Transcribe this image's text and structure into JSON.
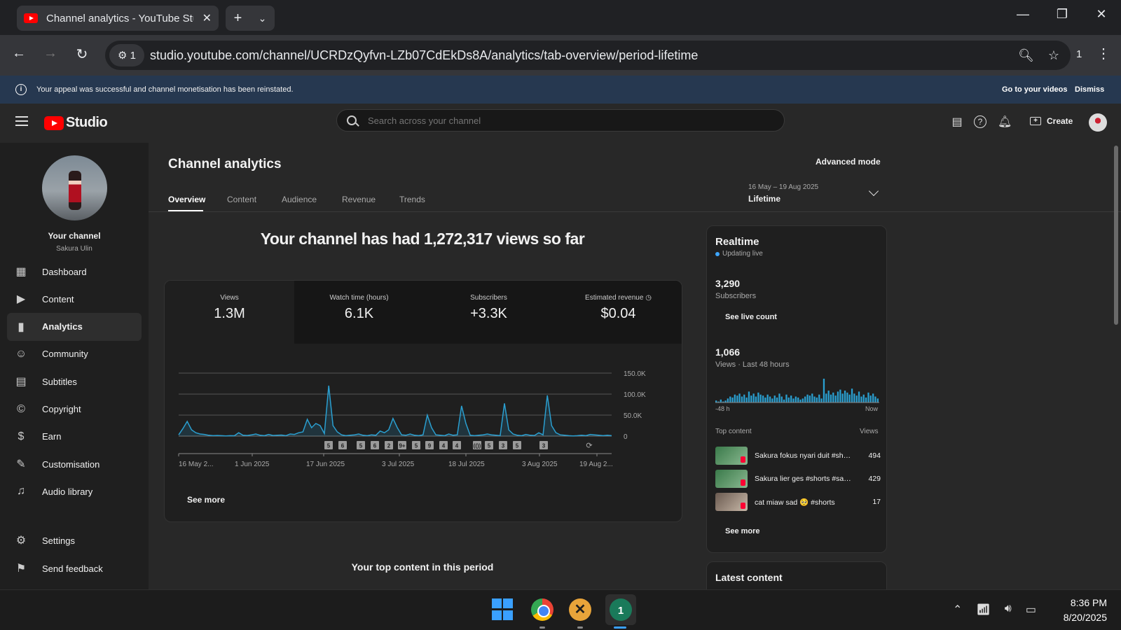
{
  "browser": {
    "tab_title": "Channel analytics - YouTube Studio",
    "url": "studio.youtube.com/channel/UCRDzQyfvn-LZb07CdEkDs8A/analytics/tab-overview/period-lifetime",
    "site_chip": "1",
    "extension_count": "1"
  },
  "banner": {
    "message": "Your appeal was successful and channel monetisation has been reinstated.",
    "go_to_videos": "Go to your videos",
    "dismiss": "Dismiss"
  },
  "studio": {
    "logo_text": "Studio",
    "search_placeholder": "Search across your channel",
    "create_label": "Create"
  },
  "channel": {
    "name": "Your channel",
    "handle": "Sakura Ulin"
  },
  "sidebar": {
    "items": [
      {
        "label": "Dashboard",
        "icon": "dashboard-icon"
      },
      {
        "label": "Content",
        "icon": "content-icon"
      },
      {
        "label": "Analytics",
        "icon": "analytics-icon",
        "active": true
      },
      {
        "label": "Community",
        "icon": "community-icon"
      },
      {
        "label": "Subtitles",
        "icon": "subtitles-icon"
      },
      {
        "label": "Copyright",
        "icon": "copyright-icon"
      },
      {
        "label": "Earn",
        "icon": "earn-icon"
      },
      {
        "label": "Customisation",
        "icon": "customisation-icon"
      },
      {
        "label": "Audio library",
        "icon": "audio-library-icon"
      }
    ],
    "settings": "Settings",
    "feedback": "Send feedback"
  },
  "page": {
    "title": "Channel analytics",
    "advanced_mode": "Advanced mode",
    "tabs": [
      "Overview",
      "Content",
      "Audience",
      "Revenue",
      "Trends"
    ],
    "date_range": "16 May – 19 Aug 2025",
    "period": "Lifetime",
    "headline": "Your channel has had 1,272,317 views so far",
    "see_more": "See more",
    "top_content_title": "Your top content in this period"
  },
  "metrics": [
    {
      "label": "Views",
      "value": "1.3M"
    },
    {
      "label": "Watch time (hours)",
      "value": "6.1K"
    },
    {
      "label": "Subscribers",
      "value": "+3.3K"
    },
    {
      "label": "Estimated revenue",
      "value": "$0.04"
    }
  ],
  "chart_data": {
    "type": "line",
    "title": "",
    "xlabel": "",
    "ylabel": "",
    "ylim": [
      0,
      150000
    ],
    "y_ticks": [
      "150.0K",
      "100.0K",
      "50.0K",
      "0"
    ],
    "x_ticks": [
      "16 May 2...",
      "1 Jun 2025",
      "17 Jun 2025",
      "3 Jul 2025",
      "18 Jul 2025",
      "3 Aug 2025",
      "19 Aug 2..."
    ],
    "series": [
      {
        "values": [
          3000,
          18000,
          35000,
          15000,
          8000,
          5000,
          4000,
          2000,
          1000,
          1500,
          1000,
          500,
          1000,
          800,
          8000,
          2000,
          1500,
          3000,
          5000,
          2000,
          1000,
          4000,
          1500,
          2000,
          2500,
          1000,
          5000,
          4000,
          8000,
          10000,
          40000,
          20000,
          30000,
          25000,
          6000,
          120000,
          25000,
          10000,
          3000,
          1000,
          2000,
          3000,
          5000,
          2000,
          1000,
          3000,
          2000,
          12000,
          8000,
          15000,
          42000,
          20000,
          3000,
          2000,
          5000,
          2000,
          1000,
          3000,
          50000,
          20000,
          3000,
          2000,
          1000,
          5000,
          2000,
          3000,
          72000,
          30000,
          2000,
          1000,
          2000,
          3000,
          5000,
          3000,
          2000,
          1000,
          78000,
          15000,
          5000,
          2000,
          1000,
          4000,
          2000,
          1500,
          8000,
          3000,
          97000,
          25000,
          8000,
          3000,
          2000,
          1000,
          500,
          1000,
          2000,
          1000,
          4000,
          3000,
          2000,
          1000,
          2000,
          1000
        ]
      }
    ],
    "markers": [
      "5",
      "6",
      "5",
      "6",
      "2",
      "9+",
      "5",
      "9",
      "4",
      "4",
      "(())",
      "5",
      "3",
      "5",
      "3"
    ]
  },
  "realtime": {
    "title": "Realtime",
    "live_label": "Updating live",
    "subscribers": "3,290",
    "subscribers_label": "Subscribers",
    "see_live_count": "See live count",
    "views": "1,066",
    "views_label": "Views · Last 48 hours",
    "left_label": "-48 h",
    "right_label": "Now",
    "hourly_views": [
      2,
      1,
      3,
      1,
      2,
      4,
      6,
      5,
      8,
      7,
      9,
      6,
      8,
      5,
      11,
      7,
      9,
      6,
      10,
      8,
      7,
      5,
      8,
      6,
      4,
      7,
      5,
      9,
      6,
      3,
      8,
      5,
      7,
      4,
      6,
      5,
      3,
      4,
      6,
      8,
      7,
      9,
      6,
      5,
      8,
      4,
      24,
      9,
      12,
      8,
      10,
      7,
      11,
      13,
      9,
      12,
      10,
      8,
      14,
      9,
      7,
      11,
      6,
      8,
      5,
      10,
      7,
      9,
      6,
      4
    ],
    "top_content_label": "Top content",
    "views_col": "Views",
    "items": [
      {
        "title": "Sakura fokus nyari duit #shorts",
        "views": "494"
      },
      {
        "title": "Sakura lier ges #shorts #sakura",
        "views": "429"
      },
      {
        "title": "cat miaw sad 🥺 #shorts",
        "views": "17"
      }
    ],
    "see_more": "See more"
  },
  "latest": {
    "title": "Latest content"
  },
  "taskbar": {
    "time": "8:36 PM",
    "date": "8/20/2025",
    "active_app_badge": "1"
  }
}
